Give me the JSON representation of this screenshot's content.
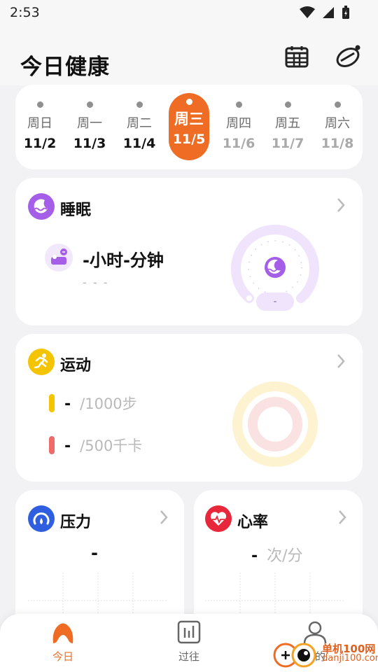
{
  "status_bar": {
    "time": "2:53"
  },
  "header": {
    "title": "今日健康"
  },
  "week": [
    {
      "weekday": "周日",
      "date": "11/2",
      "state": "past"
    },
    {
      "weekday": "周一",
      "date": "11/3",
      "state": "past"
    },
    {
      "weekday": "周二",
      "date": "11/4",
      "state": "past"
    },
    {
      "weekday": "周三",
      "date": "11/5",
      "state": "selected"
    },
    {
      "weekday": "周四",
      "date": "11/6",
      "state": "future"
    },
    {
      "weekday": "周五",
      "date": "11/7",
      "state": "future"
    },
    {
      "weekday": "周六",
      "date": "11/8",
      "state": "future"
    }
  ],
  "sleep": {
    "title": "睡眠",
    "duration": "-小时-分钟",
    "sub": "- - -",
    "gauge_value": "-"
  },
  "sport": {
    "title": "运动",
    "steps_value": "-",
    "steps_goal": "/1000步",
    "cal_value": "-",
    "cal_goal": "/500千卡"
  },
  "stress": {
    "title": "压力",
    "value": "-"
  },
  "heart": {
    "title": "心率",
    "value": "-",
    "unit": "次/分"
  },
  "tabs": [
    {
      "label": "今日",
      "active": true
    },
    {
      "label": "过往",
      "active": false
    },
    {
      "label": "我的",
      "active": false
    }
  ],
  "watermark": {
    "line1": "单机100网",
    "line2": "danji100.com"
  },
  "colors": {
    "accent": "#ef6c24",
    "sleep": "#a45ee8",
    "sport": "#f5c400",
    "calorie": "#f06a6a",
    "stress": "#2f5fe0",
    "heart": "#e8283a"
  }
}
